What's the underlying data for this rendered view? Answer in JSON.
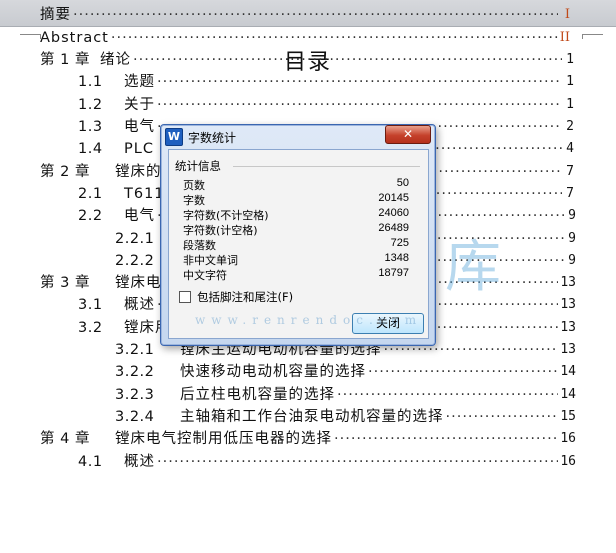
{
  "document": {
    "title": "目录"
  },
  "toc": [
    {
      "num": "",
      "text": "摘要",
      "page": "I",
      "roman": true
    },
    {
      "num": "",
      "text": "Abstract",
      "page": "II",
      "roman": true
    },
    {
      "num": "第 1 章",
      "text": "绪论",
      "page": "1"
    },
    {
      "num": "1.1",
      "text": "选题",
      "page": "1"
    },
    {
      "num": "1.2",
      "text": "关于",
      "page": "1"
    },
    {
      "num": "1.3",
      "text": "电气",
      "page": "2"
    },
    {
      "num": "1.4",
      "text": "PLC 的",
      "page": "4"
    },
    {
      "num": "第 2 章",
      "text": "镗床的",
      "page": "7"
    },
    {
      "num": "2.1",
      "text": "T611",
      "page": "7"
    },
    {
      "num": "2.2",
      "text": "电气",
      "page": "9"
    },
    {
      "num": "2.2.1",
      "text": "",
      "page": "9"
    },
    {
      "num": "2.2.2",
      "text": "",
      "page": "9"
    },
    {
      "num": "第 3 章",
      "text": "镗床电力拖动电动机的选择",
      "page": "13"
    },
    {
      "num": "3.1",
      "text": "概述",
      "page": "13"
    },
    {
      "num": "3.2",
      "text": "镗床用电动机容量的选择",
      "page": "13"
    },
    {
      "num": "3.2.1",
      "text": "镗床主运动电动机容量的选择",
      "page": "13"
    },
    {
      "num": "3.2.2",
      "text": "快速移动电动机容量的选择",
      "page": "14"
    },
    {
      "num": "3.2.3",
      "text": "后立柱电机容量的选择",
      "page": "14"
    },
    {
      "num": "3.2.4",
      "text": "主轴箱和工作台油泵电动机容量的选择",
      "page": "15"
    },
    {
      "num": "第 4 章",
      "text": "镗床电气控制用低压电器的选择",
      "page": "16"
    },
    {
      "num": "4.1",
      "text": "概述",
      "page": "16"
    }
  ],
  "dialog": {
    "title": "字数统计",
    "app_icon_letter": "W",
    "close_symbol": "✕",
    "section_label": "统计信息",
    "stats": [
      {
        "label": "页数",
        "value": "50"
      },
      {
        "label": "字数",
        "value": "20145"
      },
      {
        "label": "字符数(不计空格)",
        "value": "24060"
      },
      {
        "label": "字符数(计空格)",
        "value": "26489"
      },
      {
        "label": "段落数",
        "value": "725"
      },
      {
        "label": "非中文单词",
        "value": "1348"
      },
      {
        "label": "中文字符",
        "value": "18797"
      }
    ],
    "checkbox_label": "包括脚注和尾注(F)",
    "checkbox_checked": false,
    "close_button": "关闭"
  },
  "watermark": {
    "text": "人人文库",
    "url": "www.renrendoc.com"
  }
}
